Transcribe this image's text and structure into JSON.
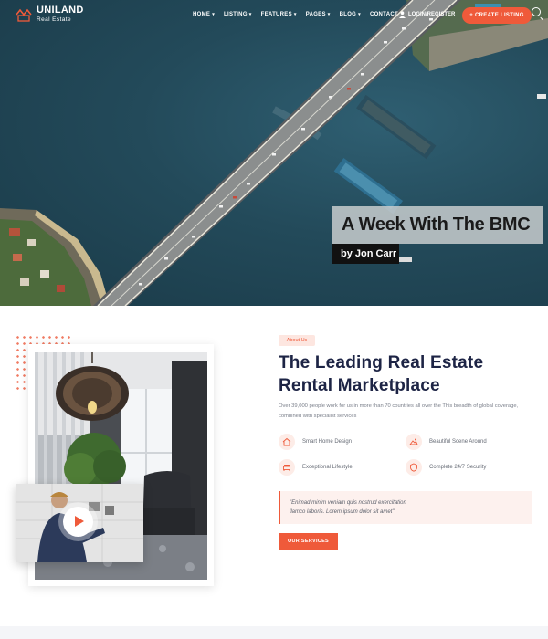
{
  "brand": {
    "name": "UNILAND",
    "tagline": "Real Estate",
    "accent": "#ef5a3a"
  },
  "nav": {
    "items": [
      {
        "label": "HOME",
        "dropdown": true
      },
      {
        "label": "LISTING",
        "dropdown": true
      },
      {
        "label": "FEATURES",
        "dropdown": true
      },
      {
        "label": "PAGES",
        "dropdown": true
      },
      {
        "label": "BLOG",
        "dropdown": true
      },
      {
        "label": "CONTACT",
        "dropdown": false
      }
    ],
    "login_label": "LOGIN/REGISTER",
    "cta_label": "+ CREATE LISTING",
    "icons": {
      "user": "user-icon",
      "search": "search-icon",
      "caret": "chevron-down-icon"
    }
  },
  "hero": {
    "caption_title": "A Week With The BMC",
    "caption_author": "by Jon Carr"
  },
  "about": {
    "badge": "About Us",
    "heading_line1": "The Leading Real Estate",
    "heading_line2": "Rental Marketplace",
    "description": "Over 39,000 people work for us in more than 70 countries all over the This breadth of global coverage, combined with specialist services",
    "features": [
      {
        "label": "Smart Home Design",
        "icon": "smart-home-icon"
      },
      {
        "label": "Beautiful Scene Around",
        "icon": "scene-icon"
      },
      {
        "label": "Exceptional Lifestyle",
        "icon": "lifestyle-icon"
      },
      {
        "label": "Complete 24/7 Security",
        "icon": "security-icon"
      }
    ],
    "quote_line1": "\"Enimad minim veniam quis nostrud exercitation",
    "quote_line2": "llamco laboris. Lorem ipsum dolor sit amet\"",
    "button_label": "OUR SERVICES"
  }
}
